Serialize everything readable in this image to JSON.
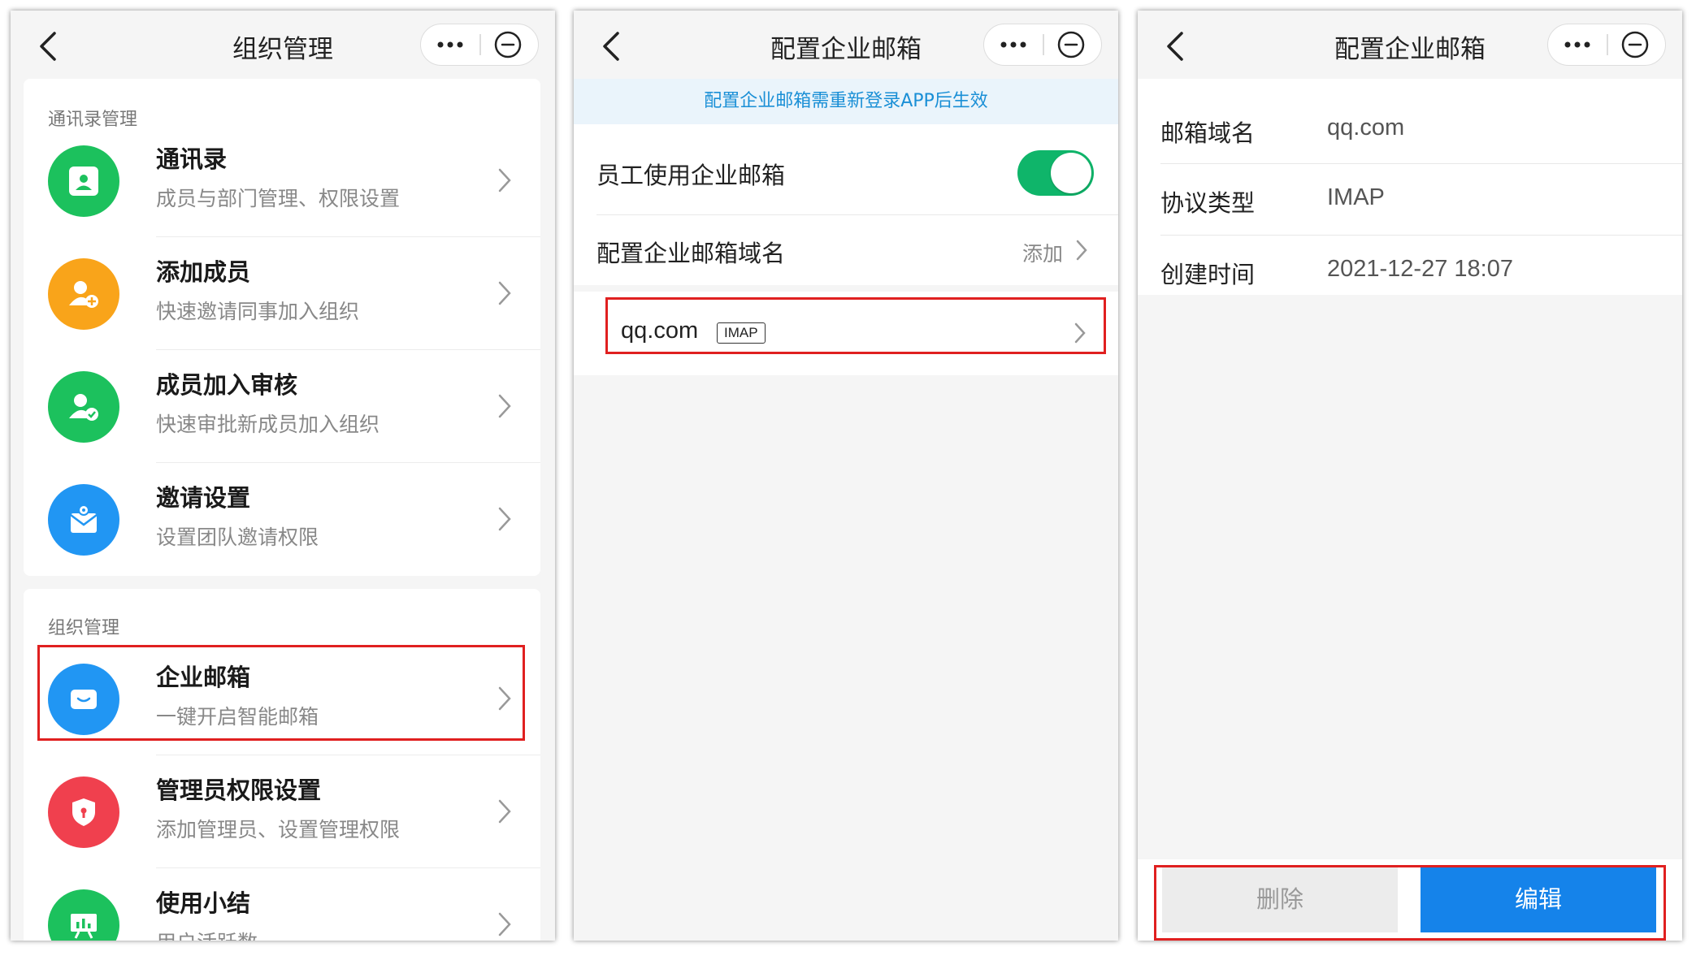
{
  "screen1": {
    "title": "组织管理",
    "section1_label": "通讯录管理",
    "section1_items": [
      {
        "title": "通讯录",
        "subtitle": "成员与部门管理、权限设置",
        "icon": "contact-card-icon",
        "color": "#1cc15d"
      },
      {
        "title": "添加成员",
        "subtitle": "快速邀请同事加入组织",
        "icon": "add-user-icon",
        "color": "#f9a41a"
      },
      {
        "title": "成员加入审核",
        "subtitle": "快速审批新成员加入组织",
        "icon": "user-check-icon",
        "color": "#1cc15d"
      },
      {
        "title": "邀请设置",
        "subtitle": "设置团队邀请权限",
        "icon": "invite-mail-icon",
        "color": "#2196f3"
      }
    ],
    "section2_label": "组织管理",
    "section2_items": [
      {
        "title": "企业邮箱",
        "subtitle": "一键开启智能邮箱",
        "icon": "mail-icon",
        "color": "#2196f3"
      },
      {
        "title": "管理员权限设置",
        "subtitle": "添加管理员、设置管理权限",
        "icon": "shield-icon",
        "color": "#f0404e"
      },
      {
        "title": "使用小结",
        "subtitle": "用户活跃数",
        "icon": "chart-board-icon",
        "color": "#1cc15d"
      }
    ]
  },
  "screen2": {
    "title": "配置企业邮箱",
    "notice": "配置企业邮箱需重新登录APP后生效",
    "toggle_label": "员工使用企业邮箱",
    "toggle_on": true,
    "domain_label": "配置企业邮箱域名",
    "domain_action": "添加",
    "domain_item": "qq.com",
    "domain_badge": "IMAP",
    "accent": "#0fb56a"
  },
  "screen3": {
    "title": "配置企业邮箱",
    "fields": [
      {
        "label": "邮箱域名",
        "value": "qq.com"
      },
      {
        "label": "协议类型",
        "value": "IMAP"
      },
      {
        "label": "创建时间",
        "value": "2021-12-27 18:07"
      }
    ],
    "delete_label": "删除",
    "edit_label": "编辑",
    "edit_color": "#1583ea"
  }
}
